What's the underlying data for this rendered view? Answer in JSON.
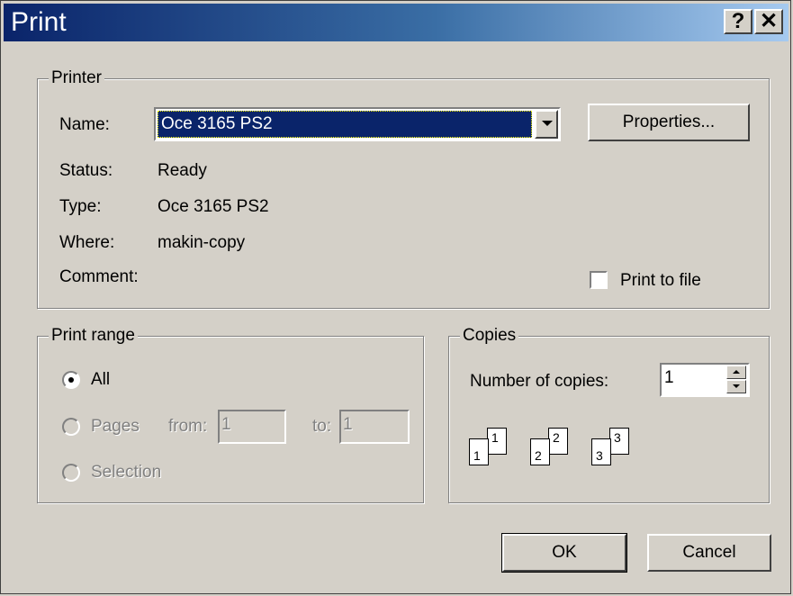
{
  "window": {
    "title": "Print",
    "help_label": "?",
    "close_label": "✕"
  },
  "printer": {
    "group_label": "Printer",
    "name_label": "Name:",
    "name_value": "Oce 3165 PS2",
    "properties_label": "Properties...",
    "status_label": "Status:",
    "status_value": "Ready",
    "type_label": "Type:",
    "type_value": "Oce 3165 PS2",
    "where_label": "Where:",
    "where_value": "makin-copy",
    "comment_label": "Comment:",
    "print_to_file_label": "Print to file",
    "print_to_file_checked": false
  },
  "print_range": {
    "group_label": "Print range",
    "all_label": "All",
    "pages_label": "Pages",
    "from_label": "from:",
    "from_value": "1",
    "to_label": "to:",
    "to_value": "1",
    "selection_label": "Selection",
    "selected": "All"
  },
  "copies": {
    "group_label": "Copies",
    "number_label": "Number of copies:",
    "number_value": "1",
    "collate_pages": [
      "1",
      "1",
      "2",
      "2",
      "3",
      "3"
    ]
  },
  "buttons": {
    "ok_label": "OK",
    "cancel_label": "Cancel"
  },
  "colors": {
    "titlebar_start": "#0a246a",
    "titlebar_end": "#a6caf0",
    "dialog_bg": "#d4d0c8",
    "selection_bg": "#0a246a"
  }
}
